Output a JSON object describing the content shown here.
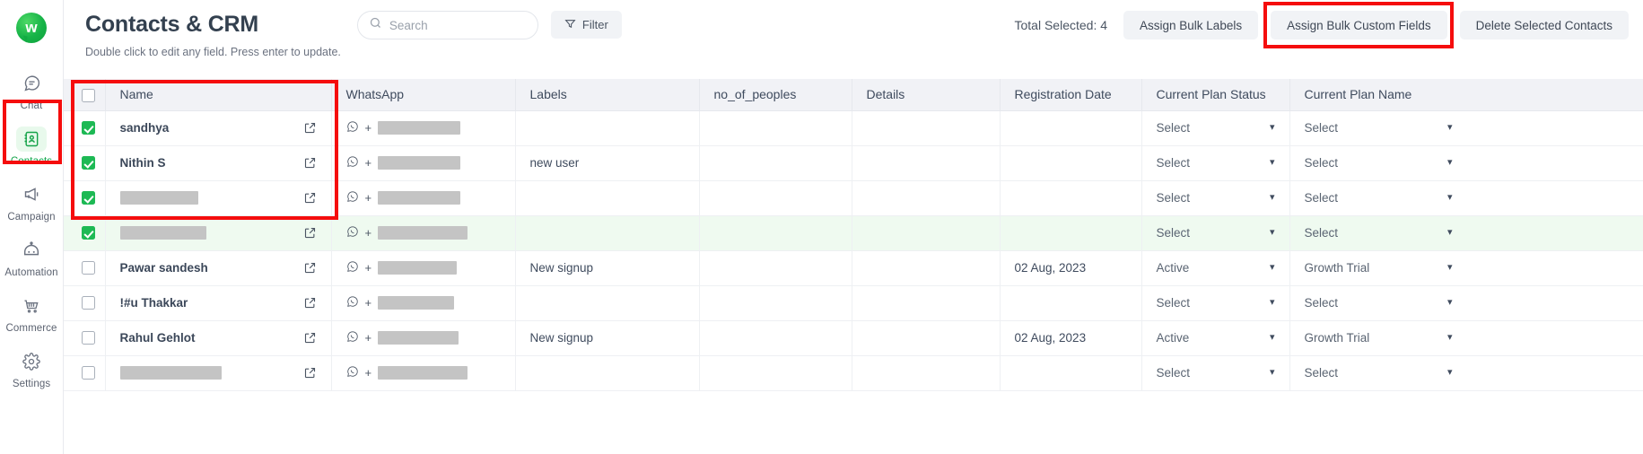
{
  "sidebar": {
    "logo_name": "wati-logo",
    "items": [
      {
        "label": "Chat",
        "icon": "chat-bubble-icon",
        "active": false
      },
      {
        "label": "Contacts",
        "icon": "contacts-book-icon",
        "active": true
      },
      {
        "label": "Campaign",
        "icon": "megaphone-icon",
        "active": false
      },
      {
        "label": "Automation",
        "icon": "robot-icon",
        "active": false
      },
      {
        "label": "Commerce",
        "icon": "shopping-cart-icon",
        "active": false
      },
      {
        "label": "Settings",
        "icon": "gear-icon",
        "active": false
      }
    ]
  },
  "header": {
    "title": "Contacts & CRM",
    "subtitle": "Double click to edit any field. Press enter to update.",
    "search_placeholder": "Search",
    "search_value": "",
    "filter_label": "Filter",
    "total_selected": "Total Selected: 4",
    "buttons": [
      {
        "label": "Assign Bulk Labels"
      },
      {
        "label": "Assign Bulk Custom Fields"
      },
      {
        "label": "Delete Selected Contacts"
      }
    ],
    "highlight_color": "#f50d0d"
  },
  "table": {
    "columns": [
      "Name",
      "WhatsApp",
      "Labels",
      "no_of_peoples",
      "Details",
      "Registration Date",
      "Current Plan Status",
      "Current Plan Name"
    ],
    "header_checkbox_checked": false,
    "rows": [
      {
        "checked": true,
        "highlight": false,
        "name": "sandhya",
        "name_redacted": false,
        "redact_width": 0,
        "wa_redact_width": 92,
        "labels": "",
        "no_of_peoples": "",
        "details": "",
        "registration_date": "",
        "current_plan_status": "Select",
        "current_plan_name": "Select"
      },
      {
        "checked": true,
        "highlight": false,
        "name": "Nithin S",
        "name_redacted": false,
        "redact_width": 0,
        "wa_redact_width": 92,
        "labels": "new user",
        "no_of_peoples": "",
        "details": "",
        "registration_date": "",
        "current_plan_status": "Select",
        "current_plan_name": "Select"
      },
      {
        "checked": true,
        "highlight": false,
        "name": "",
        "name_redacted": true,
        "redact_width": 87,
        "wa_redact_width": 92,
        "labels": "",
        "no_of_peoples": "",
        "details": "",
        "registration_date": "",
        "current_plan_status": "Select",
        "current_plan_name": "Select"
      },
      {
        "checked": true,
        "highlight": true,
        "name": "",
        "name_redacted": true,
        "redact_width": 96,
        "wa_redact_width": 100,
        "labels": "",
        "no_of_peoples": "",
        "details": "",
        "registration_date": "",
        "current_plan_status": "Select",
        "current_plan_name": "Select"
      },
      {
        "checked": false,
        "highlight": false,
        "name": "Pawar sandesh",
        "name_redacted": false,
        "redact_width": 0,
        "wa_redact_width": 88,
        "labels": "New signup",
        "no_of_peoples": "",
        "details": "",
        "registration_date": "02 Aug, 2023",
        "current_plan_status": "Active",
        "current_plan_name": "Growth Trial"
      },
      {
        "checked": false,
        "highlight": false,
        "name": "!#u Thakkar",
        "name_redacted": false,
        "redact_width": 0,
        "wa_redact_width": 85,
        "labels": "",
        "no_of_peoples": "",
        "details": "",
        "registration_date": "",
        "current_plan_status": "Select",
        "current_plan_name": "Select"
      },
      {
        "checked": false,
        "highlight": false,
        "name": "Rahul Gehlot",
        "name_redacted": false,
        "redact_width": 0,
        "wa_redact_width": 90,
        "labels": "New signup",
        "no_of_peoples": "",
        "details": "",
        "registration_date": "02 Aug, 2023",
        "current_plan_status": "Active",
        "current_plan_name": "Growth Trial"
      },
      {
        "checked": false,
        "highlight": false,
        "name": "",
        "name_redacted": true,
        "redact_width": 113,
        "wa_redact_width": 100,
        "labels": "",
        "no_of_peoples": "",
        "details": "",
        "registration_date": "",
        "current_plan_status": "Select",
        "current_plan_name": "Select"
      }
    ]
  }
}
